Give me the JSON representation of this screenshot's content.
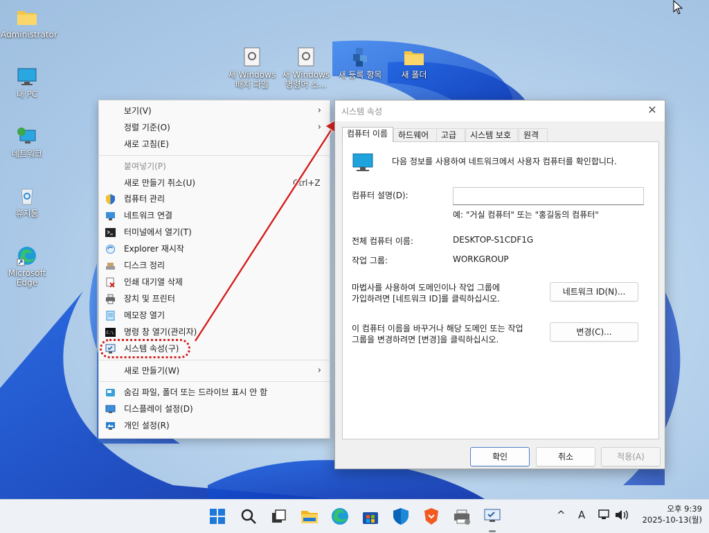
{
  "desktop_icons": [
    {
      "label": "Administrator",
      "icon": "folder-icon"
    },
    {
      "label": "내 PC",
      "icon": "monitor-icon"
    },
    {
      "label": "네트워크",
      "icon": "network-icon"
    },
    {
      "label": "휴지통",
      "icon": "recycle-bin-icon"
    },
    {
      "label": "Microsoft Edge",
      "icon": "edge-icon"
    }
  ],
  "desktop_files": [
    {
      "line1": "새 Windows",
      "line2": "배치 파일",
      "icon": "batch-file-icon"
    },
    {
      "line1": "새 Windows",
      "line2": "명령어 스...",
      "icon": "cmd-file-icon"
    },
    {
      "line1": "새 등록 항목",
      "line2": "",
      "icon": "registry-file-icon"
    },
    {
      "line1": "새 폴더",
      "line2": "",
      "icon": "folder-icon"
    }
  ],
  "context_menu": {
    "items": [
      {
        "label": "보기(V)",
        "submenu": true
      },
      {
        "label": "정렬 기준(O)",
        "submenu": true
      },
      {
        "label": "새로 고침(E)"
      },
      {
        "label": "붙여넣기(P)",
        "disabled": true
      },
      {
        "label": "새로 만들기 취소(U)",
        "shortcut": "Ctrl+Z"
      },
      {
        "label": "컴퓨터 관리",
        "icon": "shield-icon"
      },
      {
        "label": "네트워크 연결",
        "icon": "network-connections-icon"
      },
      {
        "label": "터미널에서 열기(T)",
        "icon": "terminal-icon"
      },
      {
        "label": "Explorer 재시작",
        "icon": "refresh-icon"
      },
      {
        "label": "디스크 정리",
        "icon": "disk-cleanup-icon"
      },
      {
        "label": "인쇄 대기열 삭제",
        "icon": "print-queue-icon"
      },
      {
        "label": "장치 및 프린터",
        "icon": "printer-icon"
      },
      {
        "label": "메모장 열기",
        "icon": "notepad-icon"
      },
      {
        "label": "명령 창 열기(관리자)",
        "icon": "cmd-icon"
      },
      {
        "label": "시스템 속성(구)",
        "icon": "system-properties-icon"
      },
      {
        "label": "새로 만들기(W)",
        "submenu": true
      },
      {
        "label": "숨김 파일, 폴더 또는 드라이브 표시 안 함",
        "icon": "hidden-files-icon"
      },
      {
        "label": "디스플레이 설정(D)",
        "icon": "display-icon"
      },
      {
        "label": "개인 설정(R)",
        "icon": "personalize-icon"
      }
    ]
  },
  "dialog": {
    "title": "시스템 속성",
    "close_glyph": "✕",
    "tabs": [
      "컴퓨터 이름",
      "하드웨어",
      "고급",
      "시스템 보호",
      "원격"
    ],
    "intro": "다음 정보를 사용하여 네트워크에서 사용자 컴퓨터를 확인합니다.",
    "description_label": "컴퓨터 설명(D):",
    "description_value": "",
    "description_example": "예: \"거실 컴퓨터\" 또는 \"홍길동의 컴퓨터\"",
    "full_name_label": "전체 컴퓨터 이름:",
    "full_name_value": "DESKTOP-S1CDF1G",
    "workgroup_label": "작업 그룹:",
    "workgroup_value": "WORKGROUP",
    "network_text_1": "마법사를 사용하여 도메인이나 작업 그룹에",
    "network_text_2": "가입하려면 [네트워크 ID]를 클릭하십시오.",
    "network_id_button": "네트워크 ID(N)...",
    "change_text_1": "이 컴퓨터 이름을 바꾸거나 해당 도메인 또는 작업",
    "change_text_2": "그룹을 변경하려면 [변경]을 클릭하십시오.",
    "change_button": "변경(C)...",
    "ok_button": "확인",
    "cancel_button": "취소",
    "apply_button": "적용(A)"
  },
  "taskbar": {
    "icons": [
      "start-icon",
      "search-icon",
      "task-view-icon",
      "file-explorer-icon",
      "edge-icon",
      "store-icon",
      "defender-icon",
      "brave-icon",
      "printer-settings-icon",
      "system-properties-icon"
    ],
    "tray_chevron": "^",
    "ime": "A",
    "time": "오후 9:39",
    "date": "2025-10-13(월)"
  },
  "colors": {
    "accent": "#0067c0",
    "annotation_red": "#d42020"
  }
}
